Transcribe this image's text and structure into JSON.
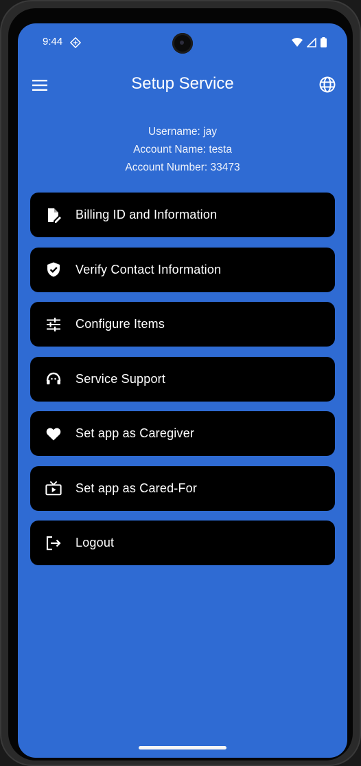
{
  "status_bar": {
    "time": "9:44"
  },
  "app_bar": {
    "title": "Setup Service"
  },
  "account": {
    "username": "Username: jay",
    "account_name": "Account Name: testa",
    "account_number": "Account Number: 33473"
  },
  "menu": {
    "items": [
      {
        "label": "Billing ID and Information",
        "icon": "edit-document-icon"
      },
      {
        "label": "Verify Contact Information",
        "icon": "shield-check-icon"
      },
      {
        "label": "Configure Items",
        "icon": "sliders-icon"
      },
      {
        "label": "Service Support",
        "icon": "headset-icon"
      },
      {
        "label": "Set app as Caregiver",
        "icon": "heart-icon"
      },
      {
        "label": "Set app as Cared-For",
        "icon": "tv-play-icon"
      },
      {
        "label": "Logout",
        "icon": "logout-icon"
      }
    ]
  },
  "colors": {
    "background": "#2f6bd3",
    "button": "#000000",
    "text": "#ffffff"
  }
}
